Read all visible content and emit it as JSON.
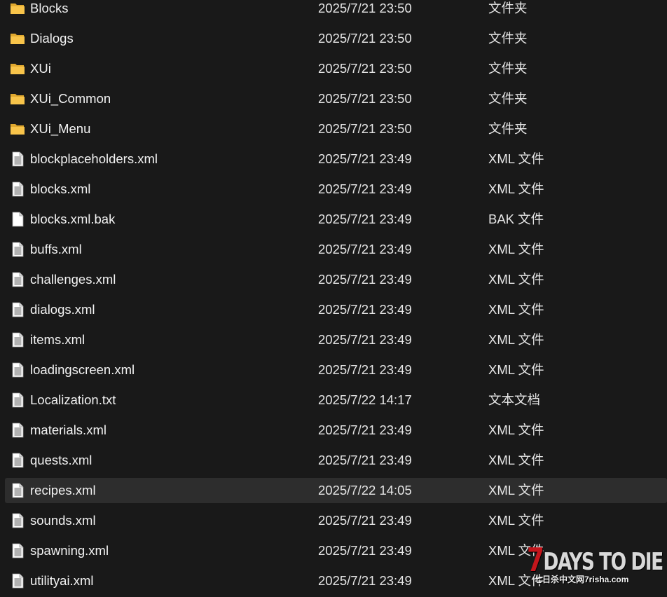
{
  "files": [
    {
      "name": "Blocks",
      "date": "2025/7/21 23:50",
      "type": "文件夹",
      "icon": "folder-icon"
    },
    {
      "name": "Dialogs",
      "date": "2025/7/21 23:50",
      "type": "文件夹",
      "icon": "folder-icon"
    },
    {
      "name": "XUi",
      "date": "2025/7/21 23:50",
      "type": "文件夹",
      "icon": "folder-icon"
    },
    {
      "name": "XUi_Common",
      "date": "2025/7/21 23:50",
      "type": "文件夹",
      "icon": "folder-icon"
    },
    {
      "name": "XUi_Menu",
      "date": "2025/7/21 23:50",
      "type": "文件夹",
      "icon": "folder-icon"
    },
    {
      "name": "blockplaceholders.xml",
      "date": "2025/7/21 23:49",
      "type": "XML 文件",
      "icon": "document-icon"
    },
    {
      "name": "blocks.xml",
      "date": "2025/7/21 23:49",
      "type": "XML 文件",
      "icon": "document-icon"
    },
    {
      "name": "blocks.xml.bak",
      "date": "2025/7/21 23:49",
      "type": "BAK 文件",
      "icon": "blank-file-icon"
    },
    {
      "name": "buffs.xml",
      "date": "2025/7/21 23:49",
      "type": "XML 文件",
      "icon": "document-icon"
    },
    {
      "name": "challenges.xml",
      "date": "2025/7/21 23:49",
      "type": "XML 文件",
      "icon": "document-icon"
    },
    {
      "name": "dialogs.xml",
      "date": "2025/7/21 23:49",
      "type": "XML 文件",
      "icon": "document-icon"
    },
    {
      "name": "items.xml",
      "date": "2025/7/21 23:49",
      "type": "XML 文件",
      "icon": "document-icon"
    },
    {
      "name": "loadingscreen.xml",
      "date": "2025/7/21 23:49",
      "type": "XML 文件",
      "icon": "document-icon"
    },
    {
      "name": "Localization.txt",
      "date": "2025/7/22 14:17",
      "type": "文本文档",
      "icon": "document-icon"
    },
    {
      "name": "materials.xml",
      "date": "2025/7/21 23:49",
      "type": "XML 文件",
      "icon": "document-icon"
    },
    {
      "name": "quests.xml",
      "date": "2025/7/21 23:49",
      "type": "XML 文件",
      "icon": "document-icon"
    },
    {
      "name": "recipes.xml",
      "date": "2025/7/22 14:05",
      "type": "XML 文件",
      "icon": "document-icon",
      "selected": true
    },
    {
      "name": "sounds.xml",
      "date": "2025/7/21 23:49",
      "type": "XML 文件",
      "icon": "document-icon"
    },
    {
      "name": "spawning.xml",
      "date": "2025/7/21 23:49",
      "type": "XML 文件",
      "icon": "document-icon"
    },
    {
      "name": "utilityai.xml",
      "date": "2025/7/21 23:49",
      "type": "XML 文件",
      "icon": "document-icon"
    }
  ],
  "watermark": {
    "seven": "7",
    "title": "DAYS TO DIE",
    "subtitle": "七日杀中文网7risha.com"
  },
  "colors": {
    "background": "#191919",
    "selected_row": "#2d2d2d",
    "folder": "#f8c44a",
    "brand_red": "#c4161c"
  }
}
